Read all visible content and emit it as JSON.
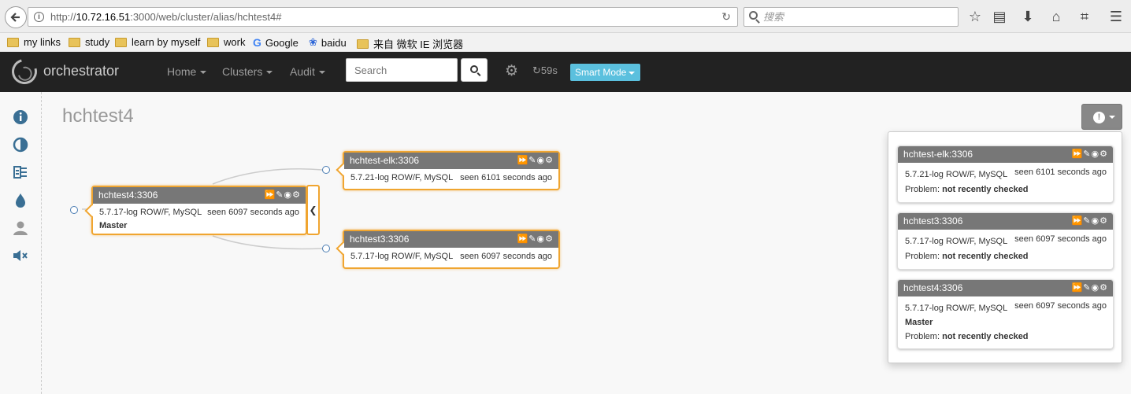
{
  "browser": {
    "url_prefix": "http://",
    "url_host": "10.72.16.51",
    "url_rest": ":3000/web/cluster/alias/hchtest4#",
    "search_placeholder": "搜索"
  },
  "bookmarks": [
    {
      "label": "my links",
      "icon": "folder-icon"
    },
    {
      "label": "study",
      "icon": "folder-icon"
    },
    {
      "label": "learn by myself",
      "icon": "folder-icon"
    },
    {
      "label": "work",
      "icon": "folder-icon"
    },
    {
      "label": "Google",
      "icon": "google-icon"
    },
    {
      "label": "baidu",
      "icon": "baidu-paw-icon"
    },
    {
      "label": "来自 微软 IE 浏览器",
      "icon": "folder-icon"
    }
  ],
  "navbar": {
    "brand": "orchestrator",
    "menus": [
      "Home",
      "Clusters",
      "Audit"
    ],
    "search_placeholder": "Search",
    "refresh_countdown": "59s",
    "mode_label": "Smart Mode"
  },
  "cluster": {
    "title": "hchtest4"
  },
  "topology": {
    "master": {
      "name": "hchtest4:3306",
      "version": "5.7.17-log ROW/F, MySQL",
      "seen": "seen 6097 seconds ago",
      "role": "Master"
    },
    "replicas": [
      {
        "name": "hchtest-elk:3306",
        "version": "5.7.21-log ROW/F, MySQL",
        "seen": "seen 6101 seconds ago"
      },
      {
        "name": "hchtest3:3306",
        "version": "5.7.17-log ROW/F, MySQL",
        "seen": "seen 6097 seconds ago"
      }
    ]
  },
  "problems": {
    "problem_label": "Problem:",
    "items": [
      {
        "name": "hchtest-elk:3306",
        "version": "5.7.21-log ROW/F, MySQL",
        "seen": "seen 6101 seconds ago",
        "role": "",
        "problem": "not recently checked"
      },
      {
        "name": "hchtest3:3306",
        "version": "5.7.17-log ROW/F, MySQL",
        "seen": "seen 6097 seconds ago",
        "role": "",
        "problem": "not recently checked"
      },
      {
        "name": "hchtest4:3306",
        "version": "5.7.17-log ROW/F, MySQL",
        "seen": "seen 6097 seconds ago",
        "role": "Master",
        "problem": "not recently checked"
      }
    ]
  },
  "colors": {
    "navbar_bg": "#222222",
    "instance_border": "#f0a530",
    "instance_header": "#777777",
    "smart_mode": "#5bc0de",
    "sidebar_icon": "#3a6f94"
  }
}
